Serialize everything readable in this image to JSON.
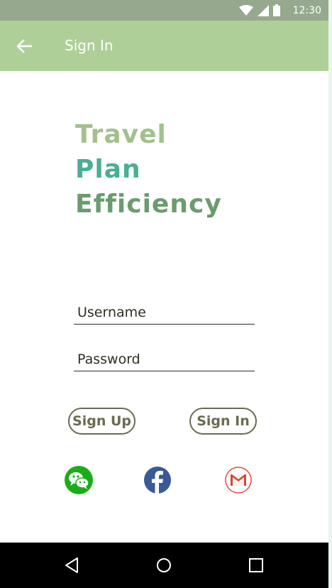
{
  "status_bar": {
    "time": "12:30",
    "icons": [
      "wifi-icon",
      "signal-icon",
      "battery-icon"
    ]
  },
  "app_bar": {
    "title": "Sign In",
    "back_icon": "arrow-left-icon"
  },
  "brand": {
    "line1": "Travel",
    "line2": "Plan",
    "line3": "Efficiency",
    "colors": [
      "#a3c08e",
      "#4aae95",
      "#6b9c6e"
    ]
  },
  "form": {
    "username_placeholder": "Username",
    "username_value": "",
    "password_placeholder": "Password",
    "password_value": ""
  },
  "buttons": {
    "sign_up": "Sign Up",
    "sign_in": "Sign In"
  },
  "social": [
    {
      "name": "wechat-icon",
      "color": "#1aad19"
    },
    {
      "name": "facebook-icon",
      "color": "#3b5998"
    },
    {
      "name": "gmail-icon",
      "color": "#d44638"
    }
  ],
  "nav_bar": {
    "icons": [
      "nav-back-icon",
      "nav-home-icon",
      "nav-recents-icon"
    ]
  },
  "theme": {
    "status_bar": "#96a98e",
    "app_bar": "#afcf98",
    "nav_bar": "#000000",
    "button_border": "#6b6b52"
  }
}
